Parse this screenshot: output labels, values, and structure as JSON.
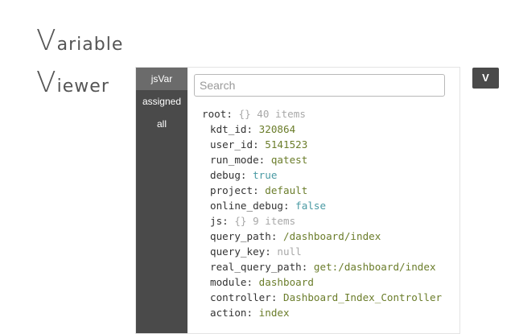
{
  "app": {
    "title_line1_cap": "V",
    "title_line1_rest": "ariable",
    "title_line2_cap": "V",
    "title_line2_rest": "iewer"
  },
  "sidebar": {
    "tabs": [
      {
        "label": "jsVar",
        "active": true
      },
      {
        "label": "assigned",
        "active": false
      },
      {
        "label": "all",
        "active": false
      }
    ]
  },
  "search": {
    "placeholder": "Search",
    "value": ""
  },
  "tree": {
    "root": {
      "key": "root",
      "meta": "{} 40 items"
    },
    "rows": [
      {
        "key": "kdt_id",
        "value": "320864",
        "type": "num"
      },
      {
        "key": "user_id",
        "value": "5141523",
        "type": "num"
      },
      {
        "key": "run_mode",
        "value": "qatest",
        "type": "str"
      },
      {
        "key": "debug",
        "value": "true",
        "type": "bool"
      },
      {
        "key": "project",
        "value": "default",
        "type": "str"
      },
      {
        "key": "online_debug",
        "value": "false",
        "type": "bool"
      },
      {
        "key": "js",
        "value": "{} 9 items",
        "type": "meta"
      },
      {
        "key": "query_path",
        "value": "/dashboard/index",
        "type": "str"
      },
      {
        "key": "query_key",
        "value": "null",
        "type": "null"
      },
      {
        "key": "real_query_path",
        "value": "get:/dashboard/index",
        "type": "str"
      },
      {
        "key": "module",
        "value": "dashboard",
        "type": "str"
      },
      {
        "key": "controller",
        "value": "Dashboard_Index_Controller",
        "type": "str"
      },
      {
        "key": "action",
        "value": "index",
        "type": "str"
      }
    ]
  },
  "toggle": {
    "label": "V"
  },
  "colors": {
    "sidebar_bg": "#4a4a4a",
    "tab_active_bg": "#6b6b6b",
    "string_value": "#6b7d2b",
    "bool_value": "#4a9aa3",
    "null_value": "#a8a8a8"
  }
}
